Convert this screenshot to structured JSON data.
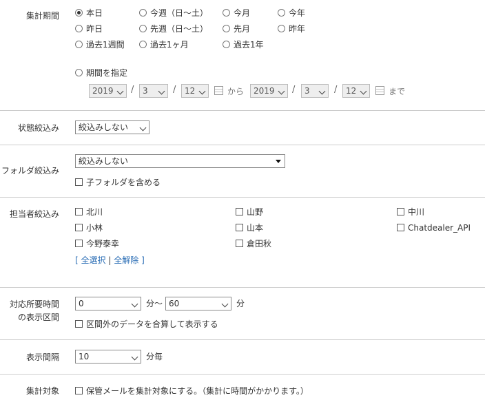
{
  "period": {
    "label": "集計期間",
    "radios": [
      {
        "label": "本日",
        "checked": true
      },
      {
        "label": "今週（日～土）",
        "checked": false
      },
      {
        "label": "今月",
        "checked": false
      },
      {
        "label": "今年",
        "checked": false
      },
      {
        "label": "昨日",
        "checked": false
      },
      {
        "label": "先週（日～土）",
        "checked": false
      },
      {
        "label": "先月",
        "checked": false
      },
      {
        "label": "昨年",
        "checked": false
      },
      {
        "label": "過去1週間",
        "checked": false
      },
      {
        "label": "過去1ヶ月",
        "checked": false
      },
      {
        "label": "過去1年",
        "checked": false
      }
    ],
    "custom_label": "期間を指定",
    "from": {
      "year": "2019",
      "month": "3",
      "day": "12"
    },
    "to": {
      "year": "2019",
      "month": "3",
      "day": "12"
    },
    "slash": "/",
    "from_text": "から",
    "to_text": "まで"
  },
  "status": {
    "label": "状態絞込み",
    "value": "絞込みしない"
  },
  "folder": {
    "label": "フォルダ絞込み",
    "value": "絞込みしない",
    "include_sub": "子フォルダを含める"
  },
  "assignee": {
    "label": "担当者絞込み",
    "people": [
      "北川",
      "山野",
      "中川",
      "小林",
      "山本",
      "Chatdealer_API",
      "今野泰幸",
      "倉田秋"
    ],
    "select_all_open": "[",
    "select_all": "全選択",
    "divider": "|",
    "clear_all": "全解除",
    "select_all_close": "]"
  },
  "duration": {
    "label1": "対応所要時間",
    "label2": "の表示区間",
    "from_value": "0",
    "from_unit": "分～",
    "to_value": "60",
    "to_unit": "分",
    "merge_label": "区間外のデータを合算して表示する"
  },
  "interval": {
    "label": "表示間隔",
    "value": "10",
    "unit": "分毎"
  },
  "target": {
    "label": "集計対象",
    "checkbox_label": "保管メールを集計対象にする。（集計に時間がかかります。）"
  }
}
